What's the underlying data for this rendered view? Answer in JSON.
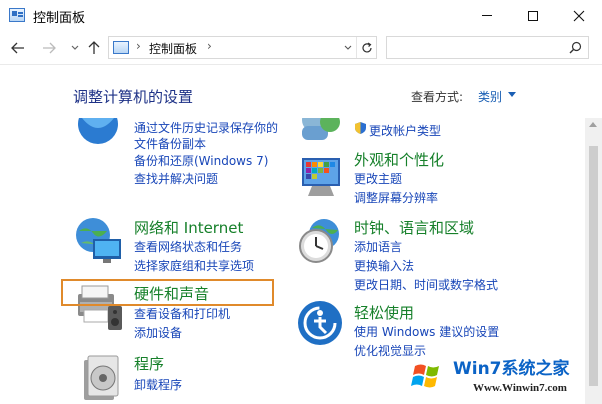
{
  "window": {
    "title": "控制面板"
  },
  "address": {
    "crumb": "控制面板",
    "sep": "›"
  },
  "search": {
    "placeholder": ""
  },
  "main": {
    "heading": "调整计算机的设置",
    "view_by_label": "查看方式:",
    "view_by_value": "类别"
  },
  "categories": {
    "system_security": {
      "links": [
        "通过文件历史记录保存你的",
        "文件备份副本",
        "备份和还原(Windows 7)",
        "查找并解决问题"
      ]
    },
    "user_accounts": {
      "links": [
        "更改帐户类型"
      ]
    },
    "appearance": {
      "title": "外观和个性化",
      "links": [
        "更改主题",
        "调整屏幕分辨率"
      ]
    },
    "network": {
      "title": "网络和 Internet",
      "links": [
        "查看网络状态和任务",
        "选择家庭组和共享选项"
      ]
    },
    "clock": {
      "title": "时钟、语言和区域",
      "links": [
        "添加语言",
        "更换输入法",
        "更改日期、时间或数字格式"
      ]
    },
    "hardware": {
      "title": "硬件和声音",
      "links": [
        "查看设备和打印机",
        "添加设备"
      ]
    },
    "ease": {
      "title": "轻松使用",
      "links": [
        "使用 Windows 建议的设置",
        "优化视觉显示"
      ]
    },
    "programs": {
      "title": "程序",
      "links": [
        "卸载程序"
      ]
    }
  },
  "watermark": {
    "text": "Win7系统之家",
    "url": "Www.Winwin7.com"
  },
  "colors": {
    "category_title": "#16802a",
    "link": "#1846b8",
    "heading": "#1e3287",
    "highlight": "#e08a2b"
  }
}
